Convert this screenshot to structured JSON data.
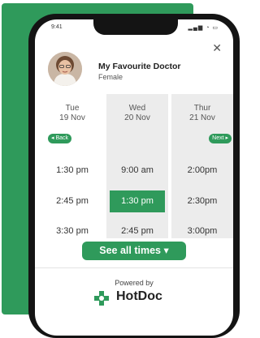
{
  "status_bar": {
    "time": "9:41",
    "icons": "▂▄▆ ◔ ▭"
  },
  "close_icon": "✕",
  "doctor": {
    "name": "My Favourite Doctor",
    "gender": "Female"
  },
  "days": [
    {
      "dow": "Tue",
      "date": "19 Nov"
    },
    {
      "dow": "Wed",
      "date": "20 Nov"
    },
    {
      "dow": "Thur",
      "date": "21 Nov"
    }
  ],
  "nav": {
    "back": "◂ Back",
    "next": "Next ▸"
  },
  "slots": [
    [
      "1:30 pm",
      "2:45 pm",
      "3:30 pm"
    ],
    [
      "9:00 am",
      "1:30 pm",
      "2:45 pm"
    ],
    [
      "2:00pm",
      "2:30pm",
      "3:00pm"
    ]
  ],
  "selected_slot": "1:30 pm",
  "see_all": "See all times ▾",
  "powered_by": "Powered by",
  "brand": "HotDoc",
  "colors": {
    "accent": "#2f9a5b",
    "column_shade": "#ececec"
  }
}
